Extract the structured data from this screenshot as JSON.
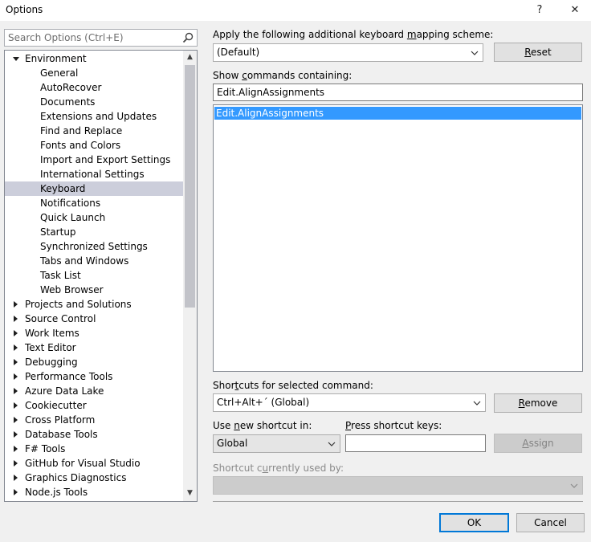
{
  "window": {
    "title": "Options",
    "help_label": "?",
    "close_label": "✕"
  },
  "search": {
    "placeholder": "Search Options (Ctrl+E)"
  },
  "tree": {
    "items": [
      {
        "label": "Environment",
        "level": 0,
        "expander": "expanded"
      },
      {
        "label": "General",
        "level": 1
      },
      {
        "label": "AutoRecover",
        "level": 1
      },
      {
        "label": "Documents",
        "level": 1
      },
      {
        "label": "Extensions and Updates",
        "level": 1
      },
      {
        "label": "Find and Replace",
        "level": 1
      },
      {
        "label": "Fonts and Colors",
        "level": 1
      },
      {
        "label": "Import and Export Settings",
        "level": 1
      },
      {
        "label": "International Settings",
        "level": 1
      },
      {
        "label": "Keyboard",
        "level": 1,
        "selected": true
      },
      {
        "label": "Notifications",
        "level": 1
      },
      {
        "label": "Quick Launch",
        "level": 1
      },
      {
        "label": "Startup",
        "level": 1
      },
      {
        "label": "Synchronized Settings",
        "level": 1
      },
      {
        "label": "Tabs and Windows",
        "level": 1
      },
      {
        "label": "Task List",
        "level": 1
      },
      {
        "label": "Web Browser",
        "level": 1
      },
      {
        "label": "Projects and Solutions",
        "level": 0,
        "expander": "collapsed"
      },
      {
        "label": "Source Control",
        "level": 0,
        "expander": "collapsed"
      },
      {
        "label": "Work Items",
        "level": 0,
        "expander": "collapsed"
      },
      {
        "label": "Text Editor",
        "level": 0,
        "expander": "collapsed"
      },
      {
        "label": "Debugging",
        "level": 0,
        "expander": "collapsed"
      },
      {
        "label": "Performance Tools",
        "level": 0,
        "expander": "collapsed"
      },
      {
        "label": "Azure Data Lake",
        "level": 0,
        "expander": "collapsed"
      },
      {
        "label": "Cookiecutter",
        "level": 0,
        "expander": "collapsed"
      },
      {
        "label": "Cross Platform",
        "level": 0,
        "expander": "collapsed"
      },
      {
        "label": "Database Tools",
        "level": 0,
        "expander": "collapsed"
      },
      {
        "label": "F# Tools",
        "level": 0,
        "expander": "collapsed"
      },
      {
        "label": "GitHub for Visual Studio",
        "level": 0,
        "expander": "collapsed"
      },
      {
        "label": "Graphics Diagnostics",
        "level": 0,
        "expander": "collapsed"
      },
      {
        "label": "Node.js Tools",
        "level": 0,
        "expander": "collapsed"
      }
    ]
  },
  "mapping": {
    "label_pre": "Apply the following additional keyboard ",
    "label_u": "m",
    "label_post": "apping scheme:",
    "value": "(Default)",
    "reset_u": "R",
    "reset_post": "eset"
  },
  "commands": {
    "label_pre": "Show ",
    "label_u": "c",
    "label_post": "ommands containing:",
    "filter_value": "Edit.AlignAssignments",
    "list": [
      "Edit.AlignAssignments"
    ]
  },
  "shortcuts": {
    "label_pre": "Shor",
    "label_u": "t",
    "label_post": "cuts for selected command:",
    "value": "Ctrl+Alt+´ (Global)",
    "remove_u": "R",
    "remove_post": "emove"
  },
  "new_shortcut": {
    "use_in_pre": "Use ",
    "use_in_u": "n",
    "use_in_post": "ew shortcut in:",
    "use_in_value": "Global",
    "press_u": "P",
    "press_post": "ress shortcut keys:",
    "press_value": "",
    "assign_u": "A",
    "assign_post": "ssign"
  },
  "used_by": {
    "label_pre": "Shortcut c",
    "label_u": "u",
    "label_post": "rrently used by:",
    "value": ""
  },
  "footer": {
    "ok_label": "OK",
    "cancel_label": "Cancel"
  }
}
